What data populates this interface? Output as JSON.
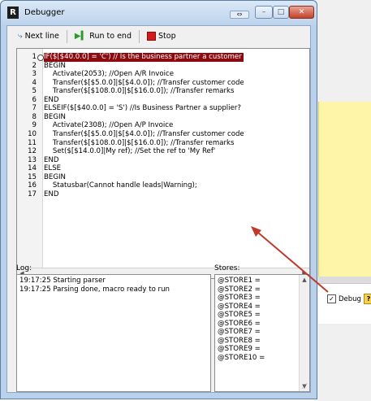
{
  "window": {
    "title": "Debugger",
    "app_icon_glyph": "R"
  },
  "toolbar": {
    "next_line": "Next line",
    "run_to_end": "Run to end",
    "stop": "Stop"
  },
  "editor": {
    "lines": [
      {
        "n": "1",
        "text": "IF($[$40.0.0] = 'C') // Is the business partner a customer",
        "highlight": true
      },
      {
        "n": "2",
        "text": "BEGIN"
      },
      {
        "n": "3",
        "text": "    Activate(2053); //Open A/R Invoice"
      },
      {
        "n": "4",
        "text": "    Transfer($[$5.0.0]|$[$4.0.0]); //Transfer customer code"
      },
      {
        "n": "5",
        "text": "    Transfer($[$108.0.0]|$[$16.0.0]); //Transfer remarks"
      },
      {
        "n": "6",
        "text": "END"
      },
      {
        "n": "7",
        "text": "ELSEIF($[$40.0.0] = 'S') //Is Business Partner a supplier?"
      },
      {
        "n": "8",
        "text": "BEGIN"
      },
      {
        "n": "9",
        "text": "    Activate(2308); //Open A/P Invoice"
      },
      {
        "n": "10",
        "text": "    Transfer($[$5.0.0]|$[$4.0.0]); //Transfer customer code"
      },
      {
        "n": "11",
        "text": "    Transfer($[$108.0.0]|$[$16.0.0]); //Transfer remarks"
      },
      {
        "n": "12",
        "text": "    Set($[$14.0.0]|My ref); //Set the ref to 'My Ref'"
      },
      {
        "n": "13",
        "text": "END"
      },
      {
        "n": "14",
        "text": "ELSE"
      },
      {
        "n": "15",
        "text": "BEGIN"
      },
      {
        "n": "16",
        "text": "    Statusbar(Cannot handle leads|Warning);"
      },
      {
        "n": "17",
        "text": "END"
      }
    ]
  },
  "log": {
    "label": "Log:",
    "entries": [
      "19:17:25  Starting parser",
      "19:17:25  Parsing done, macro ready to run"
    ]
  },
  "stores": {
    "label": "Stores:",
    "entries": [
      "@STORE1 =",
      "@STORE2 =",
      "@STORE3 =",
      "@STORE4 =",
      "@STORE5 =",
      "@STORE6 =",
      "@STORE7 =",
      "@STORE8 =",
      "@STORE9 =",
      "@STORE10 ="
    ]
  },
  "background": {
    "debug_label": "Debug",
    "debug_checked": "✓",
    "help_glyph": "?"
  },
  "colors": {
    "highlight": "#8b0b10",
    "arrow": "#c0392b",
    "title_bar": "#bcd3ec"
  }
}
